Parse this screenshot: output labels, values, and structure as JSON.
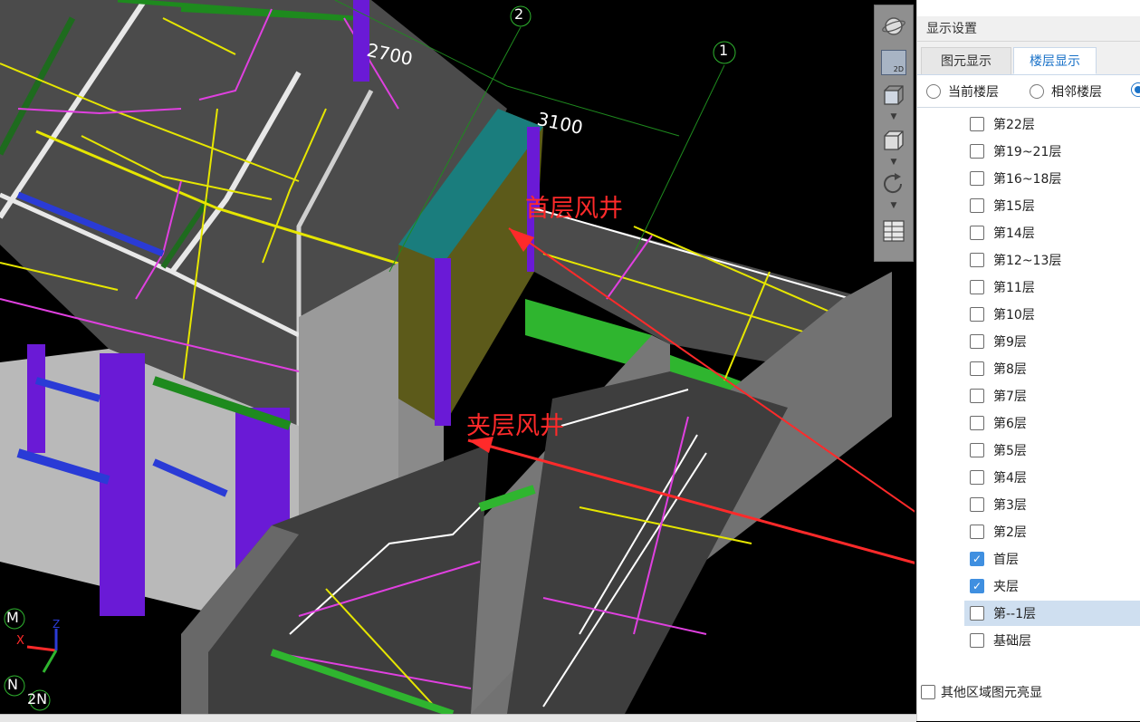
{
  "viewport": {
    "dimensions": [
      "2700",
      "3100"
    ],
    "axis_markers": [
      "2",
      "1"
    ],
    "annotations": [
      "首层风井",
      "夹层风井"
    ],
    "compass": {
      "m": "M",
      "x": "X",
      "z": "Z",
      "n": "N",
      "n2": "2N"
    }
  },
  "toolbar": {
    "view2d_label": "2D"
  },
  "panel": {
    "title": "显示设置",
    "tabs": [
      {
        "label": "图元显示",
        "active": false
      },
      {
        "label": "楼层显示",
        "active": true
      }
    ],
    "radios": [
      {
        "label": "当前楼层",
        "selected": false
      },
      {
        "label": "相邻楼层",
        "selected": false
      },
      {
        "label": "",
        "selected": true
      }
    ],
    "floors": [
      {
        "label": "第22层",
        "checked": false
      },
      {
        "label": "第19~21层",
        "checked": false
      },
      {
        "label": "第16~18层",
        "checked": false
      },
      {
        "label": "第15层",
        "checked": false
      },
      {
        "label": "第14层",
        "checked": false
      },
      {
        "label": "第12~13层",
        "checked": false
      },
      {
        "label": "第11层",
        "checked": false
      },
      {
        "label": "第10层",
        "checked": false
      },
      {
        "label": "第9层",
        "checked": false
      },
      {
        "label": "第8层",
        "checked": false
      },
      {
        "label": "第7层",
        "checked": false
      },
      {
        "label": "第6层",
        "checked": false
      },
      {
        "label": "第5层",
        "checked": false
      },
      {
        "label": "第4层",
        "checked": false
      },
      {
        "label": "第3层",
        "checked": false
      },
      {
        "label": "第2层",
        "checked": false
      },
      {
        "label": "首层",
        "checked": true
      },
      {
        "label": "夹层",
        "checked": true
      },
      {
        "label": "第--1层",
        "checked": false,
        "highlighted": true
      },
      {
        "label": "基础层",
        "checked": false
      }
    ],
    "footer_label": "其他区域图元亮显"
  },
  "colors": {
    "annotation": "#ff2a2a",
    "slab": "#4a4a4a",
    "column": "#6a1ad6",
    "beam_green": "#1e8a1e",
    "accent": "#1a72c8"
  }
}
